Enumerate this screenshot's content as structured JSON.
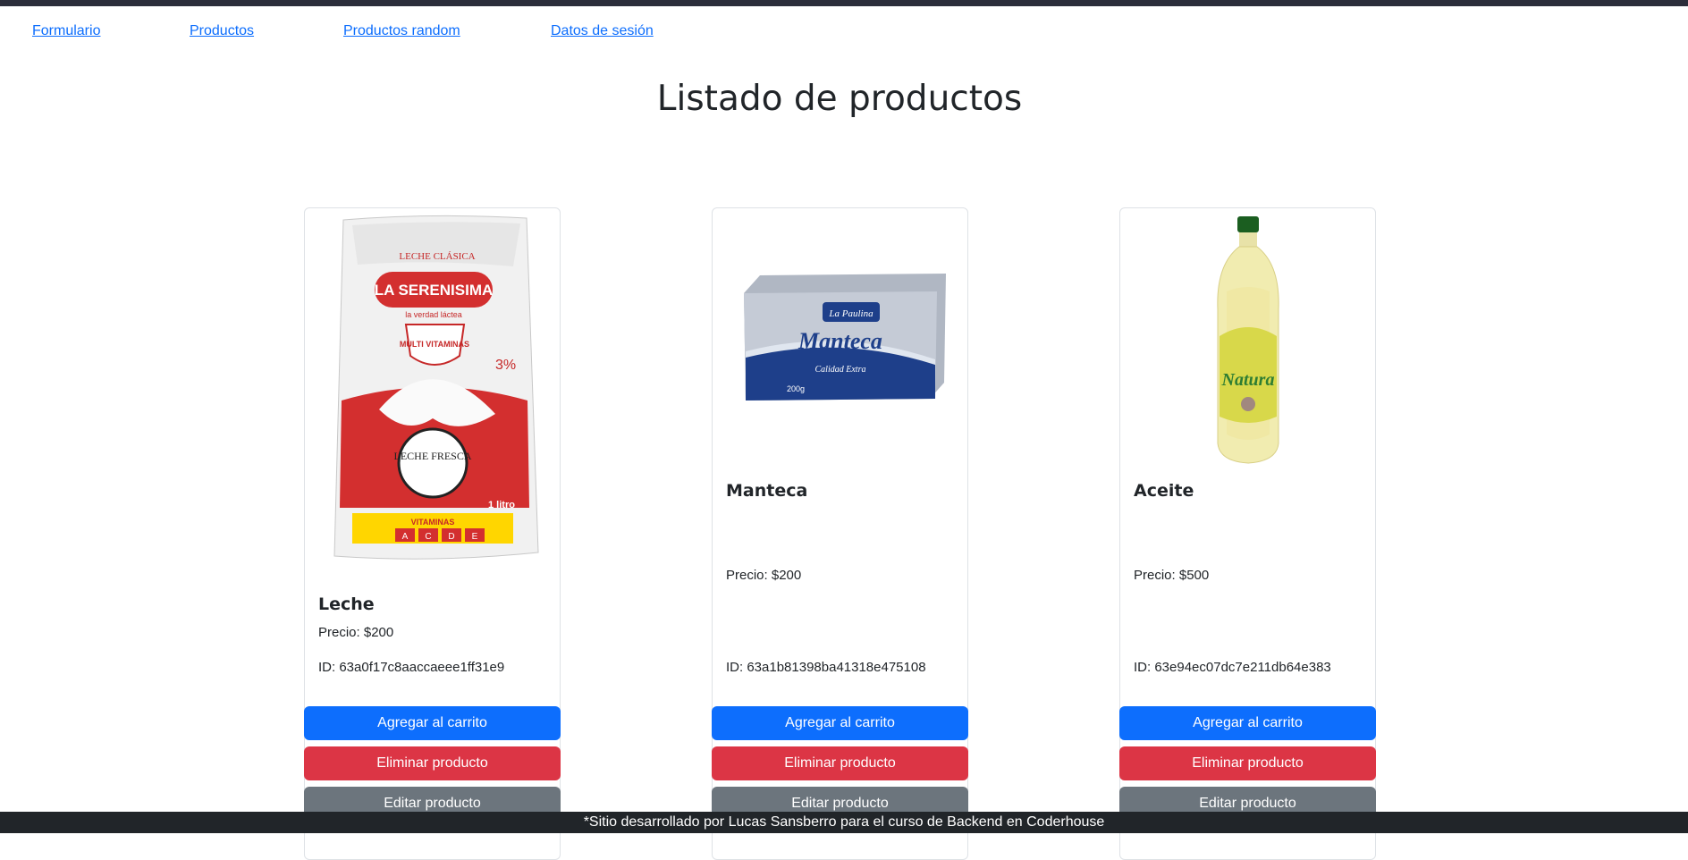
{
  "nav": {
    "formulario": "Formulario",
    "productos": "Productos",
    "productos_random": "Productos random",
    "datos_sesion": "Datos de sesión"
  },
  "page_title": "Listado de productos",
  "products": [
    {
      "name": "Leche",
      "price": "Precio: $200",
      "id": "ID: 63a0f17c8aaccaeee1ff31e9",
      "image": "milk-bag-image",
      "image_text": {
        "brand": "LA SERENISIMA",
        "line1": "LECHE CLÁSICA",
        "tagline": "la verdad láctea",
        "badge": "MULTI VITAMINAS",
        "fresh": "LECHE FRESCA",
        "vitamins": "VITAMINAS",
        "letters": [
          "A",
          "C",
          "D",
          "E"
        ],
        "volume": "1 litro",
        "fat": "3%"
      }
    },
    {
      "name": "Manteca",
      "price": "Precio: $200",
      "id": "ID: 63a1b81398ba41318e475108",
      "image": "butter-package-image",
      "image_text": {
        "brand": "La Paulina",
        "product": "Manteca",
        "quality": "Calidad Extra",
        "weight": "200g"
      }
    },
    {
      "name": "Aceite",
      "price": "Precio: $500",
      "id": "ID: 63e94ec07dc7e211db64e383",
      "image": "oil-bottle-image",
      "image_text": {
        "brand": "Natura"
      }
    }
  ],
  "buttons": {
    "add": "Agregar al carrito",
    "delete": "Eliminar producto",
    "edit": "Editar producto"
  },
  "footer": "*Sitio desarrollado por Lucas Sansberro para el curso de Backend en Coderhouse",
  "colors": {
    "primary": "#0d6efd",
    "danger": "#dc3545",
    "secondary": "#6c757d",
    "dark": "#212529",
    "topbar": "#2b2d3a"
  }
}
